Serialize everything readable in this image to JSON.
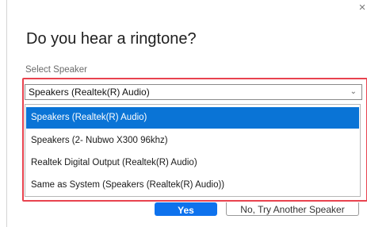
{
  "dialog": {
    "close_glyph": "×",
    "title": "Do you hear a ringtone?",
    "select_label": "Select Speaker"
  },
  "speaker_select": {
    "selected_value": "Speakers (Realtek(R) Audio)",
    "chevron_glyph": "⌄",
    "options": [
      {
        "label": "Speakers (Realtek(R) Audio)",
        "selected": true
      },
      {
        "label": "Speakers (2- Nubwo X300  96khz)",
        "selected": false
      },
      {
        "label": "Realtek Digital Output (Realtek(R) Audio)",
        "selected": false
      },
      {
        "label": "Same as System (Speakers (Realtek(R) Audio))",
        "selected": false
      }
    ]
  },
  "actions": {
    "yes_label": "Yes",
    "try_another_label": "No, Try Another Speaker"
  },
  "colors": {
    "accent": "#0e72ed",
    "selected_option": "#0a74d6",
    "highlight_border": "#e8434f"
  }
}
